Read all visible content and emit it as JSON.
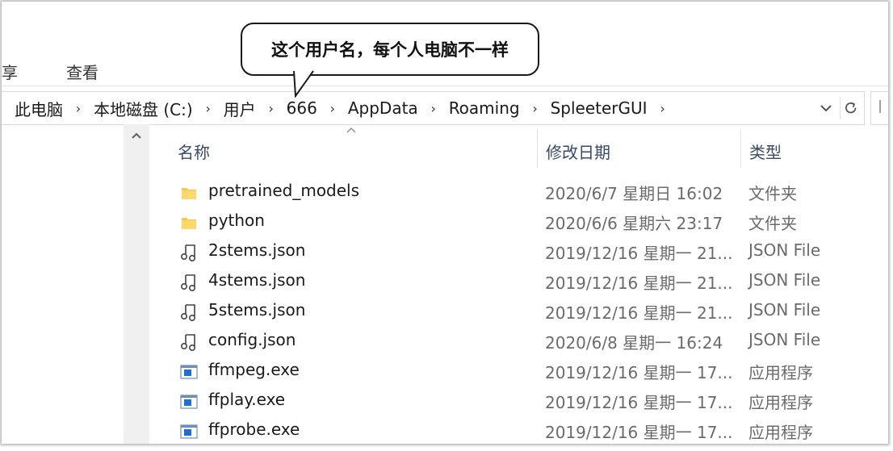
{
  "ribbon": {
    "tabs": [
      "享",
      "查看"
    ]
  },
  "breadcrumb": {
    "items": [
      "此电脑",
      "本地磁盘 (C:)",
      "用户",
      "666",
      "AppData",
      "Roaming",
      "SpleeterGUI"
    ],
    "separator": "›"
  },
  "columns": {
    "name": "名称",
    "date": "修改日期",
    "type": "类型"
  },
  "files": [
    {
      "name": "pretrained_models",
      "date": "2020/6/7 星期日 16:02",
      "type": "文件夹",
      "icon": "folder-icon"
    },
    {
      "name": "python",
      "date": "2020/6/6 星期六 23:17",
      "type": "文件夹",
      "icon": "folder-icon"
    },
    {
      "name": "2stems.json",
      "date": "2019/12/16 星期一 21...",
      "type": "JSON File",
      "icon": "json-file-icon"
    },
    {
      "name": "4stems.json",
      "date": "2019/12/16 星期一 21...",
      "type": "JSON File",
      "icon": "json-file-icon"
    },
    {
      "name": "5stems.json",
      "date": "2019/12/16 星期一 21...",
      "type": "JSON File",
      "icon": "json-file-icon"
    },
    {
      "name": "config.json",
      "date": "2020/6/8 星期一 16:24",
      "type": "JSON File",
      "icon": "json-file-icon"
    },
    {
      "name": "ffmpeg.exe",
      "date": "2019/12/16 星期一 17...",
      "type": "应用程序",
      "icon": "exe-icon"
    },
    {
      "name": "ffplay.exe",
      "date": "2019/12/16 星期一 17...",
      "type": "应用程序",
      "icon": "exe-icon"
    },
    {
      "name": "ffprobe.exe",
      "date": "2019/12/16 星期一 17...",
      "type": "应用程序",
      "icon": "exe-icon"
    }
  ],
  "callout": {
    "text": "这个用户名，每个人电脑不一样"
  },
  "colors": {
    "folder": "#f6c84a",
    "header_text": "#3a4a6a",
    "secondary_text": "#6b6b6b"
  }
}
